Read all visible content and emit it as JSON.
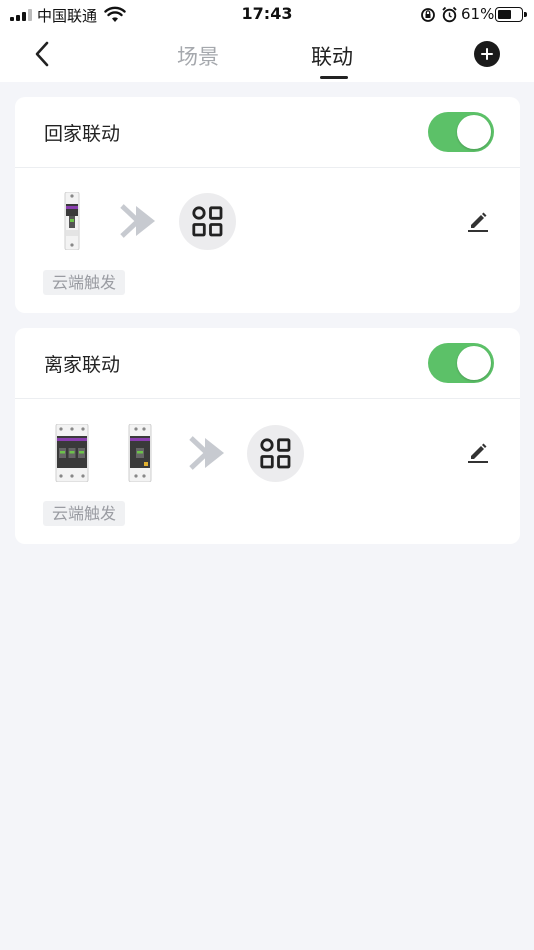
{
  "status_bar": {
    "carrier": "中国联通",
    "time": "17:43",
    "battery_percent": "61%",
    "battery_level": 0.61
  },
  "nav": {
    "tabs": [
      {
        "label": "场景",
        "active": false
      },
      {
        "label": "联动",
        "active": true
      }
    ],
    "back_icon": "chevron-left-icon",
    "add_icon": "plus-circle-icon"
  },
  "linkages": [
    {
      "title": "回家联动",
      "enabled": true,
      "trigger_tag": "云端触发",
      "devices": [
        "breaker-1p"
      ]
    },
    {
      "title": "离家联动",
      "enabled": true,
      "trigger_tag": "云端触发",
      "devices": [
        "breaker-3p",
        "breaker-1p-wide"
      ]
    }
  ],
  "colors": {
    "toggle_on": "#5cc168",
    "background": "#f4f5f9",
    "accent_text": "#222222"
  }
}
